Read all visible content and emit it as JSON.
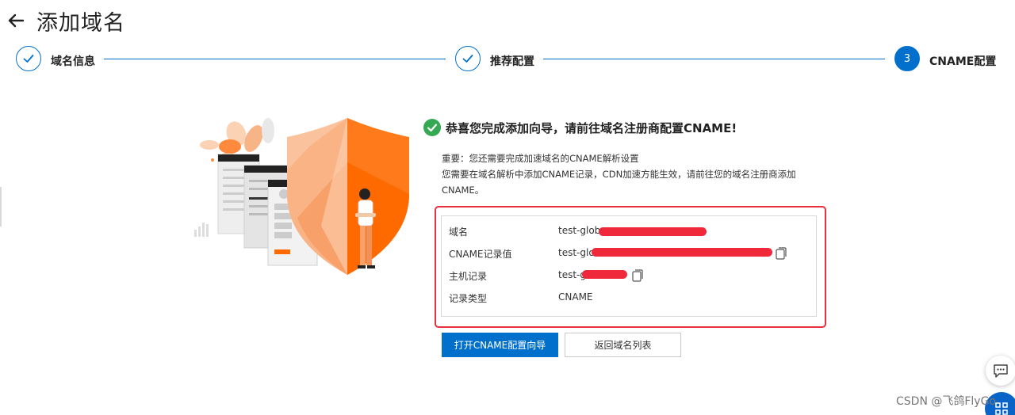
{
  "header": {
    "title": "添加域名",
    "back_icon": "arrow-left-icon"
  },
  "steps": [
    {
      "label": "域名信息",
      "state": "done",
      "icon": "check-icon"
    },
    {
      "label": "推荐配置",
      "state": "done",
      "icon": "check-icon"
    },
    {
      "label": "CNAME配置",
      "state": "active",
      "number": "3"
    }
  ],
  "success": {
    "title": "恭喜您完成添加向导，请前往域名注册商配置CNAME!",
    "icon": "check-circle-icon",
    "lines": [
      "重要：您还需要完成加速域名的CNAME解析设置",
      "您需要在域名解析中添加CNAME记录，CDN加速方能生效，请前往您的域名注册商添加",
      "CNAME。"
    ]
  },
  "records": [
    {
      "label": "域名",
      "value": "test-glob",
      "copy": false
    },
    {
      "label": "CNAME记录值",
      "value": "test-glo",
      "copy": true
    },
    {
      "label": "主机记录",
      "value": "test-g",
      "copy": true
    },
    {
      "label": "记录类型",
      "value": "CNAME",
      "copy": false
    }
  ],
  "buttons": {
    "primary": "打开CNAME配置向导",
    "secondary": "返回域名列表"
  },
  "watermark": "CSDN @飞鸽FlyGo",
  "colors": {
    "primary": "#0070cc",
    "success": "#35a853",
    "highlight": "#e8303e",
    "accent_orange": "#ff6a00"
  }
}
